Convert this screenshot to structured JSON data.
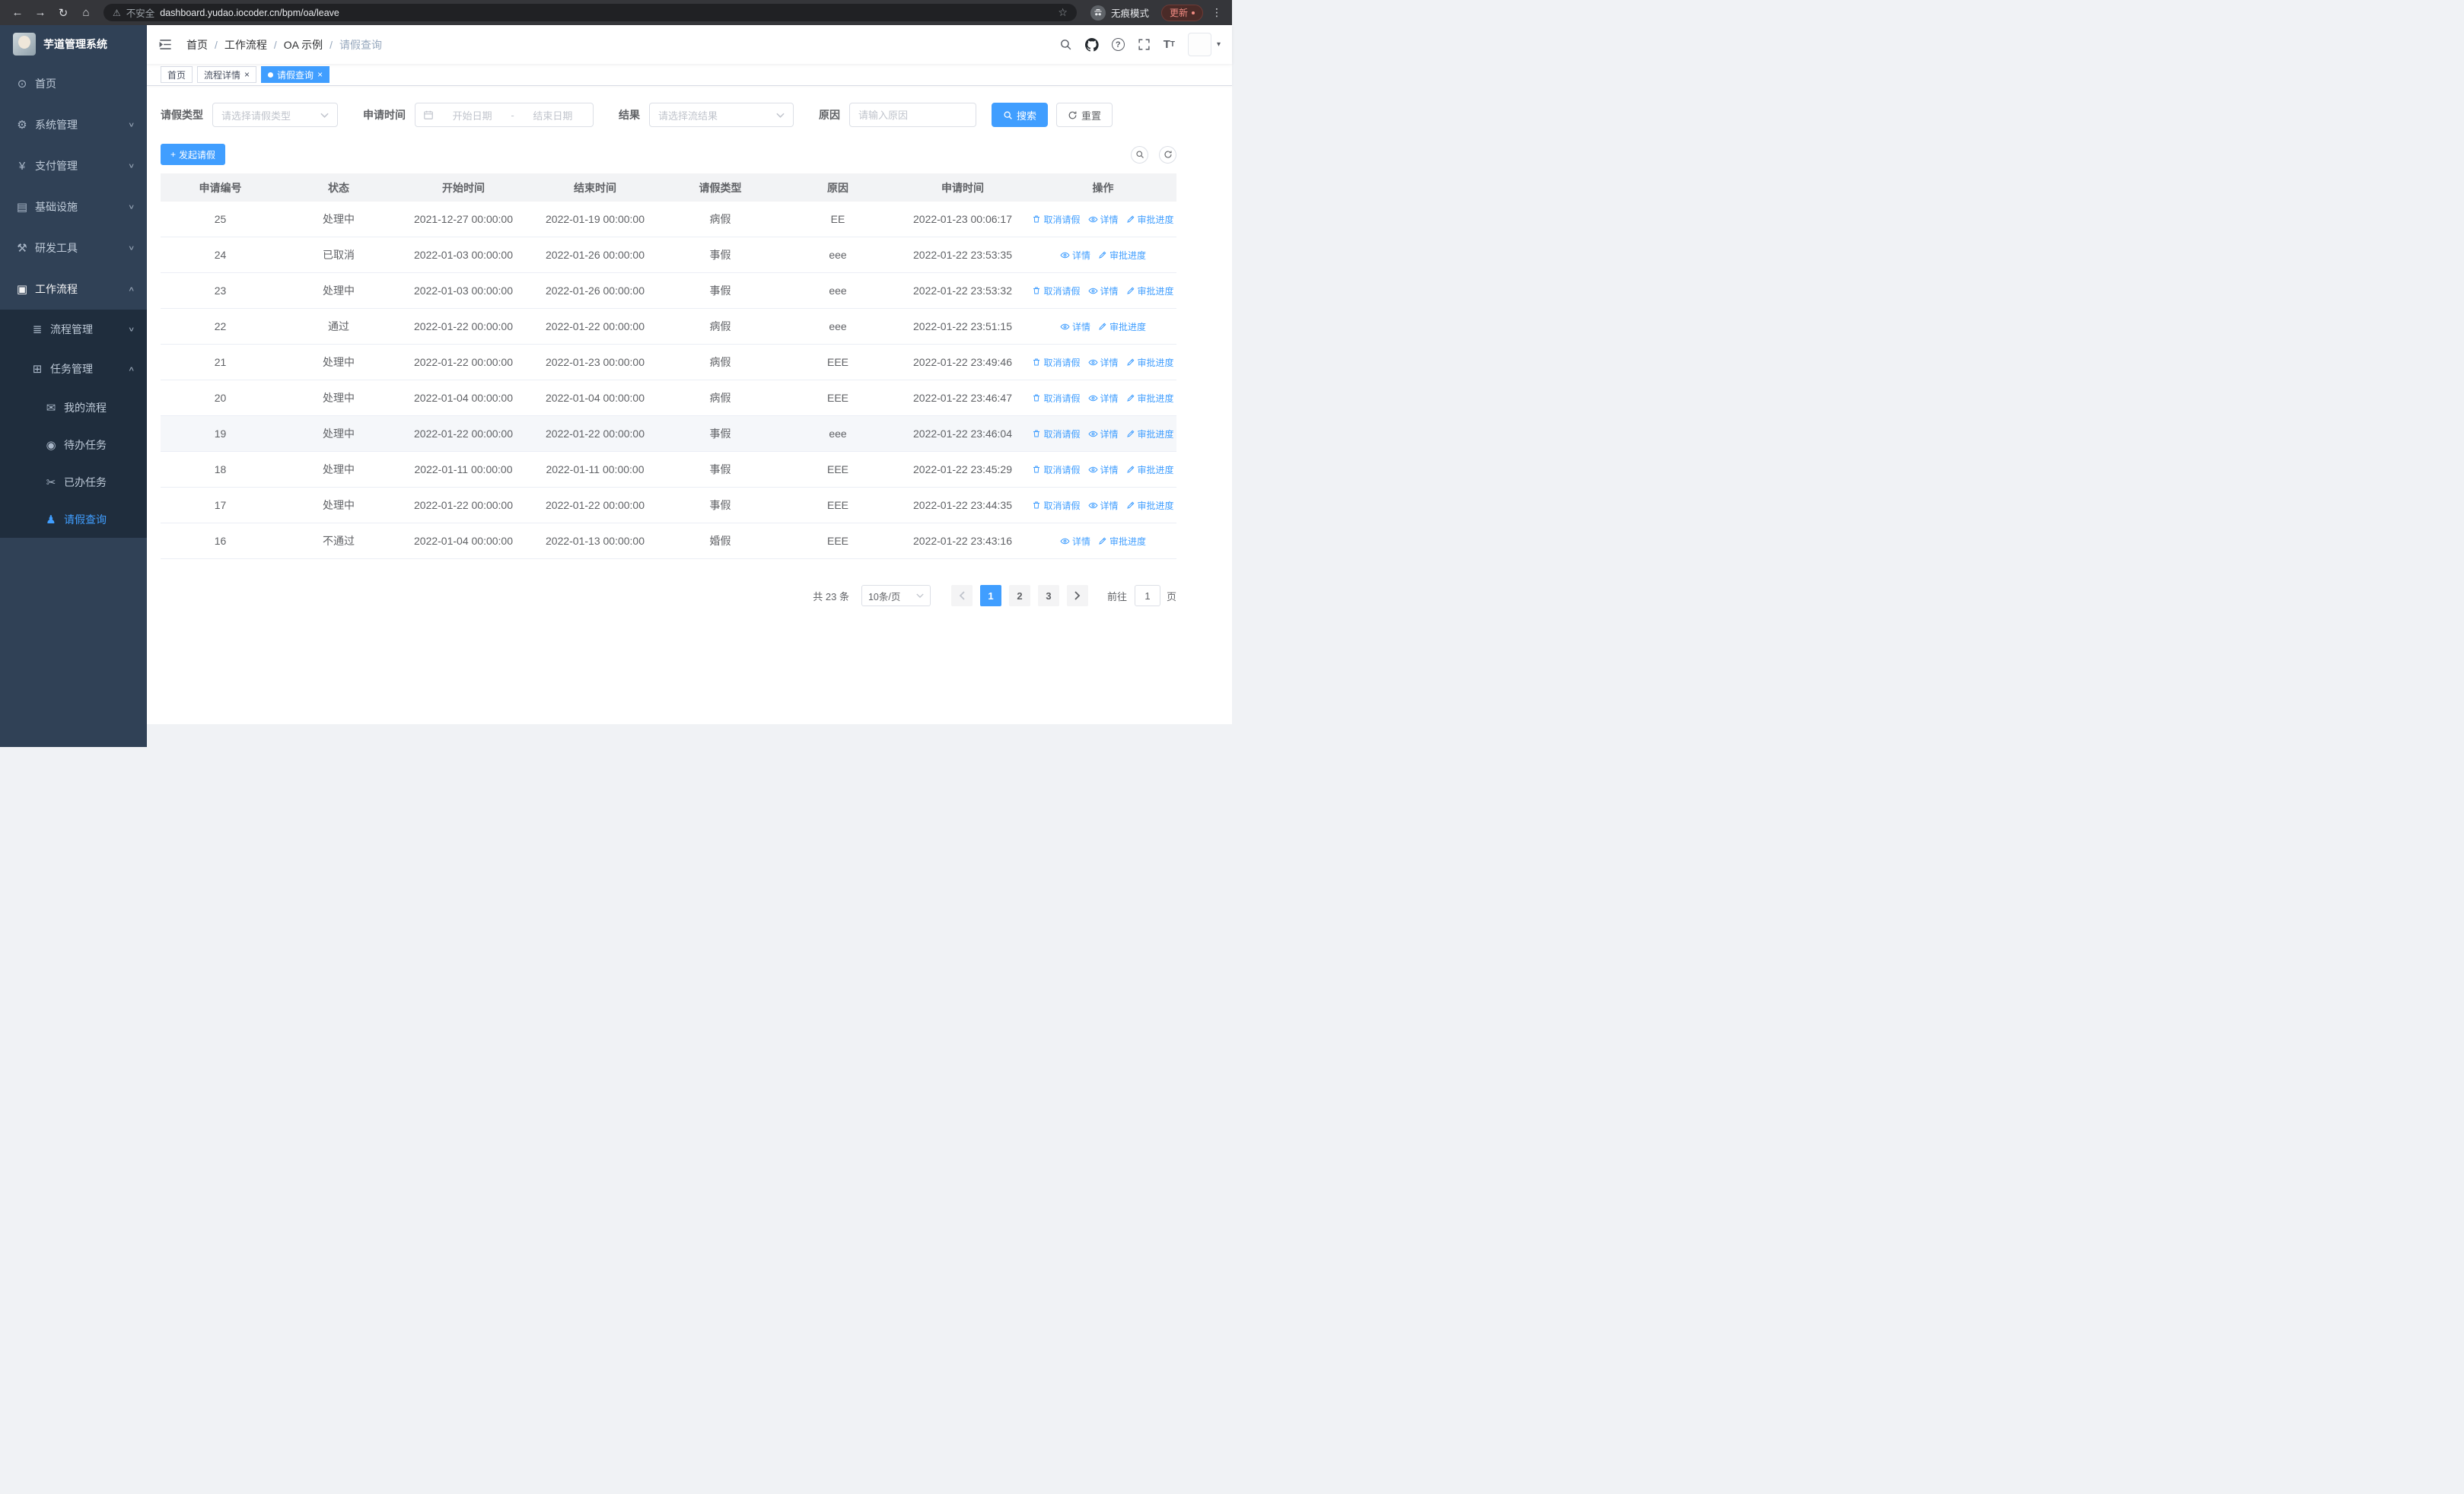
{
  "browser": {
    "security_warning": "不安全",
    "url": "dashboard.yudao.iocoder.cn/bpm/oa/leave",
    "incognito_label": "无痕模式",
    "update_label": "更新"
  },
  "colors": {
    "accent": "#409eff",
    "sidebar_bg": "#304156",
    "submenu_bg": "#1f2d3d"
  },
  "sidebar": {
    "app_title": "芋道管理系统",
    "items": [
      {
        "label": "首页",
        "icon": "dashboard-icon"
      },
      {
        "label": "系统管理",
        "icon": "gear-icon",
        "expandable": true
      },
      {
        "label": "支付管理",
        "icon": "yen-icon",
        "expandable": true
      },
      {
        "label": "基础设施",
        "icon": "server-icon",
        "expandable": true
      },
      {
        "label": "研发工具",
        "icon": "tools-icon",
        "expandable": true
      },
      {
        "label": "工作流程",
        "icon": "briefcase-icon",
        "expanded": true,
        "children": [
          {
            "label": "流程管理",
            "icon": "list-icon",
            "expandable": true
          },
          {
            "label": "任务管理",
            "icon": "task-icon",
            "expanded": true,
            "children": [
              {
                "label": "我的流程",
                "icon": "message-icon"
              },
              {
                "label": "待办任务",
                "icon": "eye-icon"
              },
              {
                "label": "已办任务",
                "icon": "scissors-icon"
              },
              {
                "label": "请假查询",
                "icon": "user-icon",
                "active": true
              }
            ]
          }
        ]
      }
    ]
  },
  "header": {
    "breadcrumb": [
      "首页",
      "工作流程",
      "OA 示例",
      "请假查询"
    ]
  },
  "tabs": [
    {
      "label": "首页",
      "active": false,
      "closable": false
    },
    {
      "label": "流程详情",
      "active": false,
      "closable": true
    },
    {
      "label": "请假查询",
      "active": true,
      "closable": true
    }
  ],
  "filters": {
    "leave_type_label": "请假类型",
    "leave_type_placeholder": "请选择请假类型",
    "apply_time_label": "申请时间",
    "start_date_placeholder": "开始日期",
    "range_separator": "-",
    "end_date_placeholder": "结束日期",
    "result_label": "结果",
    "result_placeholder": "请选择流结果",
    "reason_label": "原因",
    "reason_placeholder": "请输入原因",
    "search_label": "搜索",
    "reset_label": "重置"
  },
  "toolbar": {
    "create_label": "发起请假"
  },
  "table": {
    "columns": [
      "申请编号",
      "状态",
      "开始时间",
      "结束时间",
      "请假类型",
      "原因",
      "申请时间",
      "操作"
    ],
    "action_labels": {
      "cancel": "取消请假",
      "detail": "详情",
      "progress": "审批进度"
    },
    "rows": [
      {
        "id": "25",
        "status": "处理中",
        "start": "2021-12-27 00:00:00",
        "end": "2022-01-19 00:00:00",
        "type": "病假",
        "reason": "EE",
        "applied": "2022-01-23 00:06:17",
        "actions": [
          "cancel",
          "detail",
          "progress"
        ],
        "highlight": false
      },
      {
        "id": "24",
        "status": "已取消",
        "start": "2022-01-03 00:00:00",
        "end": "2022-01-26 00:00:00",
        "type": "事假",
        "reason": "eee",
        "applied": "2022-01-22 23:53:35",
        "actions": [
          "detail",
          "progress"
        ],
        "highlight": false
      },
      {
        "id": "23",
        "status": "处理中",
        "start": "2022-01-03 00:00:00",
        "end": "2022-01-26 00:00:00",
        "type": "事假",
        "reason": "eee",
        "applied": "2022-01-22 23:53:32",
        "actions": [
          "cancel",
          "detail",
          "progress"
        ],
        "highlight": false
      },
      {
        "id": "22",
        "status": "通过",
        "start": "2022-01-22 00:00:00",
        "end": "2022-01-22 00:00:00",
        "type": "病假",
        "reason": "eee",
        "applied": "2022-01-22 23:51:15",
        "actions": [
          "detail",
          "progress"
        ],
        "highlight": false
      },
      {
        "id": "21",
        "status": "处理中",
        "start": "2022-01-22 00:00:00",
        "end": "2022-01-23 00:00:00",
        "type": "病假",
        "reason": "EEE",
        "applied": "2022-01-22 23:49:46",
        "actions": [
          "cancel",
          "detail",
          "progress"
        ],
        "highlight": false
      },
      {
        "id": "20",
        "status": "处理中",
        "start": "2022-01-04 00:00:00",
        "end": "2022-01-04 00:00:00",
        "type": "病假",
        "reason": "EEE",
        "applied": "2022-01-22 23:46:47",
        "actions": [
          "cancel",
          "detail",
          "progress"
        ],
        "highlight": false
      },
      {
        "id": "19",
        "status": "处理中",
        "start": "2022-01-22 00:00:00",
        "end": "2022-01-22 00:00:00",
        "type": "事假",
        "reason": "eee",
        "applied": "2022-01-22 23:46:04",
        "actions": [
          "cancel",
          "detail",
          "progress"
        ],
        "highlight": true
      },
      {
        "id": "18",
        "status": "处理中",
        "start": "2022-01-11 00:00:00",
        "end": "2022-01-11 00:00:00",
        "type": "事假",
        "reason": "EEE",
        "applied": "2022-01-22 23:45:29",
        "actions": [
          "cancel",
          "detail",
          "progress"
        ],
        "highlight": false
      },
      {
        "id": "17",
        "status": "处理中",
        "start": "2022-01-22 00:00:00",
        "end": "2022-01-22 00:00:00",
        "type": "事假",
        "reason": "EEE",
        "applied": "2022-01-22 23:44:35",
        "actions": [
          "cancel",
          "detail",
          "progress"
        ],
        "highlight": false
      },
      {
        "id": "16",
        "status": "不通过",
        "start": "2022-01-04 00:00:00",
        "end": "2022-01-13 00:00:00",
        "type": "婚假",
        "reason": "EEE",
        "applied": "2022-01-22 23:43:16",
        "actions": [
          "detail",
          "progress"
        ],
        "highlight": false
      }
    ]
  },
  "pagination": {
    "total_label": "共 23 条",
    "page_size": "10条/页",
    "pages": [
      "1",
      "2",
      "3"
    ],
    "active_page": "1",
    "goto_label": "前往",
    "goto_value": "1",
    "page_unit": "页"
  }
}
